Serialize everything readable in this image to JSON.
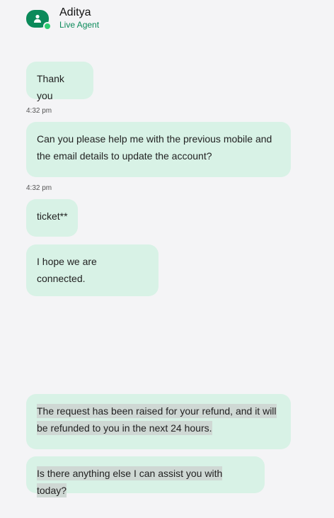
{
  "header": {
    "agent_name": "Aditya",
    "agent_status": "Live Agent",
    "avatar_icon": "user-icon",
    "accent_color": "#0b8a5a"
  },
  "messages": [
    {
      "text": "Thank you"
    },
    {
      "timestamp": "4:32 pm"
    },
    {
      "text": "Can you please help me with the previous mobile and the email details to update the account?"
    },
    {
      "timestamp": "4:32 pm"
    },
    {
      "text": "ticket**"
    },
    {
      "text": "I hope we are connected."
    },
    {
      "text": "The request has been raised for your refund, and it will be refunded to you in the next 24 hours."
    },
    {
      "text": "Is there anything else I can assist you with today?"
    }
  ]
}
